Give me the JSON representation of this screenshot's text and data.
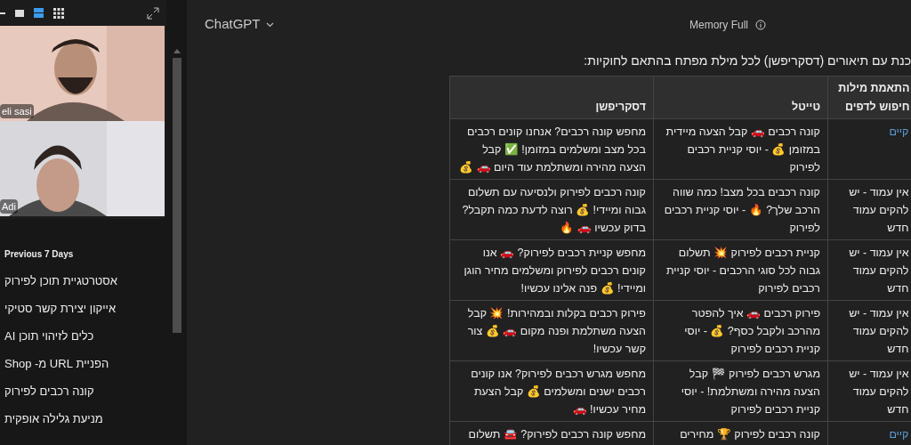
{
  "video_call": {
    "participants": [
      {
        "name": "eli sasi"
      },
      {
        "name": "Adi"
      }
    ]
  },
  "sidebar": {
    "section_title": "Previous 7 Days",
    "items": [
      {
        "label": "אסטרטגיית תוכן לפירוק"
      },
      {
        "label": "אייקון יצירת קשר סטיקי"
      },
      {
        "label": "כלים לזיהוי תוכן AI"
      },
      {
        "label": "הפניית URL מ- Shop"
      },
      {
        "label": "קונה רכבים לפירוק"
      },
      {
        "label": "מניעת גלילה אופקית"
      }
    ]
  },
  "header": {
    "model": "ChatGPT",
    "memory": "Memory Full"
  },
  "message": {
    "intro": "כנת עם תיאורים (דסקריפשן) לכל מילת מפתח בהתאם לחוקיות:",
    "table": {
      "columns": [
        "התאמת מילות חיפוש לדפים",
        "טייטל",
        "דסקריפשן"
      ],
      "rows": [
        {
          "match": "קיים",
          "kind": "link",
          "title": "קונה רכבים 🚗 קבל הצעה מיידית במזומן 💰 - יוסי קניית רכבים לפירוק",
          "description": "מחפש קונה רכבים? אנחנו קונים רכבים בכל מצב ומשלמים במזומן! ✅ קבל הצעה מהירה ומשתלמת עוד היום 🚗 💰"
        },
        {
          "match": "אין עמוד - יש להקים עמוד חדש",
          "kind": "plain",
          "title": "קונה רכבים בכל מצב! כמה שווה הרכב שלך? 🔥 - יוסי קניית רכבים לפירוק",
          "description": "קונה רכבים לפירוק ולנסיעה עם תשלום גבוה ומיידי! 💰 רוצה לדעת כמה תקבל? בדוק עכשיו 🚗 🔥"
        },
        {
          "match": "אין עמוד - יש להקים עמוד חדש",
          "kind": "plain",
          "title": "קניית רכבים לפירוק 💥 תשלום גבוה לכל סוגי הרכבים - יוסי קניית רכבים לפירוק",
          "description": "מחפש קניית רכבים לפירוק? 🚗 אנו קונים רכבים לפירוק ומשלמים מחיר הוגן ומיידי! 💰 פנה אלינו עכשיו!"
        },
        {
          "match": "אין עמוד - יש להקים עמוד חדש",
          "kind": "plain",
          "title": "פירוק רכבים 🚗 איך להפטר מהרכב ולקבל כסף? 💰 - יוסי קניית רכבים לפירוק",
          "description": "פירוק רכבים בקלות ובמהירות! 💥 קבל הצעה משתלמת ופנה מקום 🚗 💰 צור קשר עכשיו!"
        },
        {
          "match": "אין עמוד - יש להקים עמוד חדש",
          "kind": "plain",
          "title": "מגרש רכבים לפירוק 🏁 קבל הצעה מהירה ומשתלמת! - יוסי קניית רכבים לפירוק",
          "description": "מחפש מגרש רכבים לפירוק? אנו קונים רכבים ישנים ומשלמים 💰 קבל הצעת מחיר עכשיו! 🚗"
        },
        {
          "match": "קיים",
          "kind": "link",
          "title": "קונה רכבים לפירוק 🏆 מחירים",
          "description": "מחפש קונה רכבים לפירוק? 🚘 תשלום"
        }
      ]
    }
  }
}
